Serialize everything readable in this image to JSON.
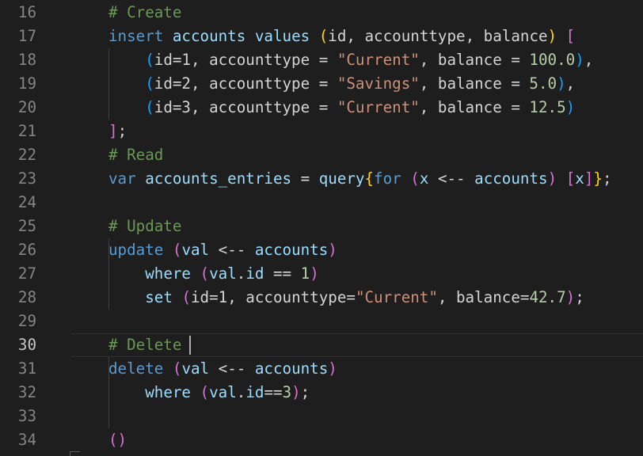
{
  "editor": {
    "active_line": 30,
    "colors": {
      "background": "#1e1e1e",
      "comment": "#6a9955",
      "keyword": "#569cd6",
      "keyword_control": "#c586c0",
      "identifier": "#9cdcfe",
      "string": "#ce9178",
      "number": "#b5cea8",
      "bracket_level_1": "#da70d6",
      "bracket_level_2": "#179fff",
      "bracket_level_3": "#ffd700",
      "text": "#d4d4d4"
    },
    "lines": [
      {
        "num": "16",
        "tokens": [
          {
            "t": "    "
          },
          {
            "t": "# Create",
            "c": "comment"
          }
        ]
      },
      {
        "num": "17",
        "tokens": [
          {
            "t": "    "
          },
          {
            "t": "insert",
            "c": "keyword"
          },
          {
            "t": " "
          },
          {
            "t": "accounts",
            "c": "identifier"
          },
          {
            "t": " "
          },
          {
            "t": "values",
            "c": "identifier"
          },
          {
            "t": " "
          },
          {
            "t": "(",
            "c": "bracket_level_3"
          },
          {
            "t": "id, accounttype, balance"
          },
          {
            "t": ")",
            "c": "bracket_level_3"
          },
          {
            "t": " "
          },
          {
            "t": "[",
            "c": "bracket_level_1"
          }
        ]
      },
      {
        "num": "18",
        "tokens": [
          {
            "t": "        "
          },
          {
            "t": "(",
            "c": "bracket_level_2"
          },
          {
            "t": "id=1, accounttype = "
          },
          {
            "t": "\"Current\"",
            "c": "string"
          },
          {
            "t": ", balance = "
          },
          {
            "t": "100.0",
            "c": "number"
          },
          {
            "t": ")",
            "c": "bracket_level_2"
          },
          {
            "t": ","
          }
        ]
      },
      {
        "num": "19",
        "tokens": [
          {
            "t": "        "
          },
          {
            "t": "(",
            "c": "bracket_level_2"
          },
          {
            "t": "id=2, accounttype = "
          },
          {
            "t": "\"Savings\"",
            "c": "string"
          },
          {
            "t": ", balance = "
          },
          {
            "t": "5.0",
            "c": "number"
          },
          {
            "t": ")",
            "c": "bracket_level_2"
          },
          {
            "t": ","
          }
        ]
      },
      {
        "num": "20",
        "tokens": [
          {
            "t": "        "
          },
          {
            "t": "(",
            "c": "bracket_level_2"
          },
          {
            "t": "id=3, accounttype = "
          },
          {
            "t": "\"Current\"",
            "c": "string"
          },
          {
            "t": ", balance = "
          },
          {
            "t": "12.5",
            "c": "number"
          },
          {
            "t": ")",
            "c": "bracket_level_2"
          }
        ]
      },
      {
        "num": "21",
        "tokens": [
          {
            "t": "    "
          },
          {
            "t": "]",
            "c": "bracket_level_1"
          },
          {
            "t": ";"
          }
        ]
      },
      {
        "num": "22",
        "tokens": [
          {
            "t": "    "
          },
          {
            "t": "# Read",
            "c": "comment"
          }
        ]
      },
      {
        "num": "23",
        "tokens": [
          {
            "t": "    "
          },
          {
            "t": "var",
            "c": "keyword"
          },
          {
            "t": " "
          },
          {
            "t": "accounts_entries",
            "c": "identifier"
          },
          {
            "t": " = "
          },
          {
            "t": "query",
            "c": "identifier"
          },
          {
            "t": "{",
            "c": "bracket_level_3"
          },
          {
            "t": "for",
            "c": "keyword"
          },
          {
            "t": " "
          },
          {
            "t": "(",
            "c": "bracket_level_1"
          },
          {
            "t": "x",
            "c": "identifier"
          },
          {
            "t": " <-- "
          },
          {
            "t": "accounts",
            "c": "identifier"
          },
          {
            "t": ")",
            "c": "bracket_level_1"
          },
          {
            "t": " "
          },
          {
            "t": "[",
            "c": "bracket_level_1"
          },
          {
            "t": "x",
            "c": "identifier"
          },
          {
            "t": "]",
            "c": "bracket_level_1"
          },
          {
            "t": "}",
            "c": "bracket_level_3"
          },
          {
            "t": ";"
          }
        ]
      },
      {
        "num": "24",
        "tokens": []
      },
      {
        "num": "25",
        "tokens": [
          {
            "t": "    "
          },
          {
            "t": "# Update",
            "c": "comment"
          }
        ]
      },
      {
        "num": "26",
        "tokens": [
          {
            "t": "    "
          },
          {
            "t": "update",
            "c": "keyword"
          },
          {
            "t": " "
          },
          {
            "t": "(",
            "c": "bracket_level_1"
          },
          {
            "t": "val",
            "c": "identifier"
          },
          {
            "t": " <-- "
          },
          {
            "t": "accounts",
            "c": "identifier"
          },
          {
            "t": ")",
            "c": "bracket_level_1"
          }
        ]
      },
      {
        "num": "27",
        "tokens": [
          {
            "t": "        "
          },
          {
            "t": "where",
            "c": "identifier"
          },
          {
            "t": " "
          },
          {
            "t": "(",
            "c": "bracket_level_1"
          },
          {
            "t": "val",
            "c": "identifier"
          },
          {
            "t": "."
          },
          {
            "t": "id",
            "c": "identifier"
          },
          {
            "t": " == "
          },
          {
            "t": "1",
            "c": "number"
          },
          {
            "t": ")",
            "c": "bracket_level_1"
          }
        ]
      },
      {
        "num": "28",
        "tokens": [
          {
            "t": "        "
          },
          {
            "t": "set",
            "c": "identifier"
          },
          {
            "t": " "
          },
          {
            "t": "(",
            "c": "bracket_level_1"
          },
          {
            "t": "id=1, accounttype="
          },
          {
            "t": "\"Current\"",
            "c": "string"
          },
          {
            "t": ", balance="
          },
          {
            "t": "42.7",
            "c": "number"
          },
          {
            "t": ")",
            "c": "bracket_level_1"
          },
          {
            "t": ";"
          }
        ]
      },
      {
        "num": "29",
        "tokens": []
      },
      {
        "num": "30",
        "tokens": [
          {
            "t": "    "
          },
          {
            "t": "# Delete ",
            "c": "comment"
          }
        ]
      },
      {
        "num": "31",
        "tokens": [
          {
            "t": "    "
          },
          {
            "t": "delete",
            "c": "keyword"
          },
          {
            "t": " "
          },
          {
            "t": "(",
            "c": "bracket_level_1"
          },
          {
            "t": "val",
            "c": "identifier"
          },
          {
            "t": " <-- "
          },
          {
            "t": "accounts",
            "c": "identifier"
          },
          {
            "t": ")",
            "c": "bracket_level_1"
          }
        ]
      },
      {
        "num": "32",
        "tokens": [
          {
            "t": "        "
          },
          {
            "t": "where",
            "c": "identifier"
          },
          {
            "t": " "
          },
          {
            "t": "(",
            "c": "bracket_level_1"
          },
          {
            "t": "val",
            "c": "identifier"
          },
          {
            "t": "."
          },
          {
            "t": "id",
            "c": "identifier"
          },
          {
            "t": "=="
          },
          {
            "t": "3",
            "c": "number"
          },
          {
            "t": ")",
            "c": "bracket_level_1"
          },
          {
            "t": ";"
          }
        ]
      },
      {
        "num": "33",
        "tokens": []
      },
      {
        "num": "34",
        "tokens": [
          {
            "t": "    "
          },
          {
            "t": "()",
            "c": "bracket_level_1"
          }
        ]
      }
    ]
  }
}
